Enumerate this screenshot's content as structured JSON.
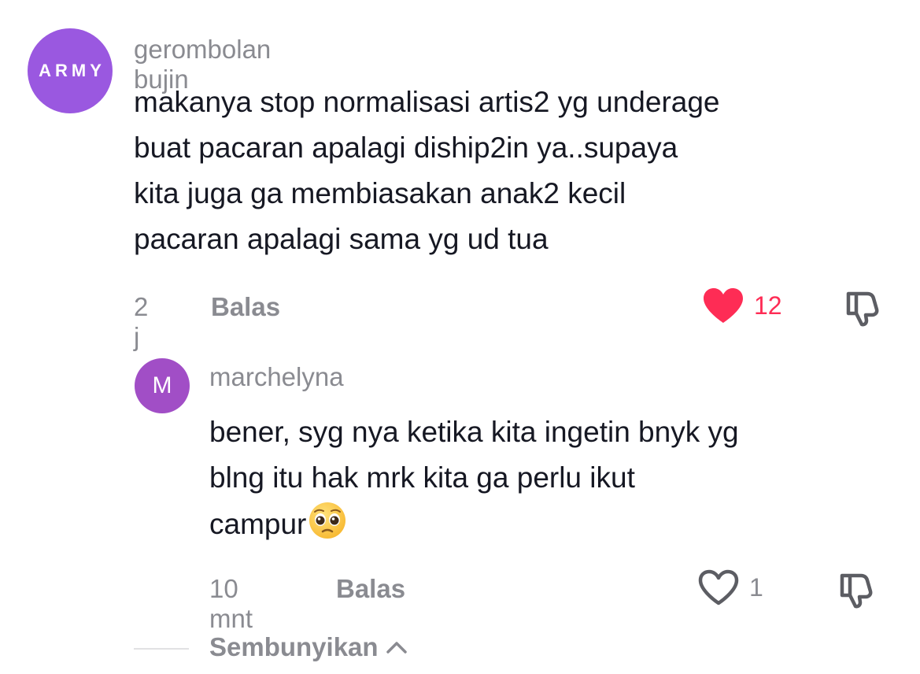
{
  "comments": [
    {
      "avatar_text": "ARMY",
      "username": "gerombolan bujin",
      "lines": [
        "makanya stop normalisasi artis2 yg underage",
        "buat pacaran apalagi diship2in ya..supaya",
        "kita juga ga membiasakan anak2 kecil",
        "pacaran apalagi sama yg ud tua"
      ],
      "time": "2 j",
      "reply_label": "Balas",
      "like_count": "12",
      "liked": true
    },
    {
      "avatar_text": "M",
      "username": "marchelyna",
      "lines": [
        "bener, syg nya ketika kita ingetin bnyk yg",
        "blng itu hak mrk kita ga perlu ikut",
        "campur"
      ],
      "emoji": "pleading-face-emoji",
      "time": "10 mnt",
      "reply_label": "Balas",
      "like_count": "1",
      "liked": false
    }
  ],
  "hide_label": "Sembunyikan",
  "colors": {
    "liked": "#fe2c55",
    "muted": "#8a8b91",
    "text": "#161823",
    "avatar1": "#9a58e0",
    "avatar2": "#a14ec6"
  }
}
